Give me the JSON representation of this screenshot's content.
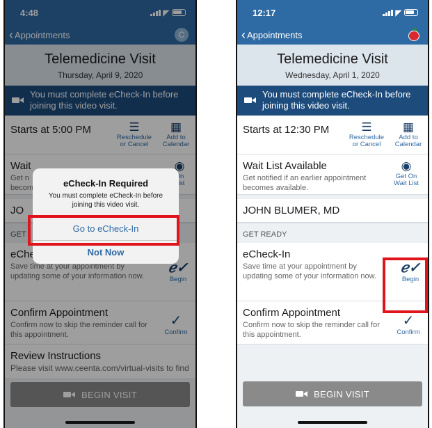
{
  "left": {
    "status": {
      "time": "4:48"
    },
    "nav": {
      "back_label": "Appointments",
      "avatar_initial": "C"
    },
    "header": {
      "title": "Telemedicine Visit",
      "date": "Thursday, April 9, 2020"
    },
    "banner": {
      "text": "You must complete eCheck-In before joining this video visit."
    },
    "starts": {
      "label": "Starts at 5:00 PM",
      "reschedule_label": "Reschedule or Cancel",
      "calendar_label": "Add to Calendar"
    },
    "waitlist": {
      "title": "Wait",
      "desc_line1": "Get n",
      "desc_line2": "becom",
      "action_label_1": "On",
      "action_label_2": "List"
    },
    "provider": {
      "name": "JO"
    },
    "section": {
      "label": "GET"
    },
    "echeckin": {
      "title": "eCheck-In",
      "desc": "Save time at your appointment by updating some of your information now.",
      "action_label": "Begin"
    },
    "confirm": {
      "title": "Confirm Appointment",
      "desc": "Confirm now to skip the reminder call for this appointment.",
      "action_label": "Confirm"
    },
    "review": {
      "title": "Review Instructions",
      "desc": "Please visit www.ceenta.com/virtual-visits to find"
    },
    "begin_visit": {
      "label": "BEGIN VISIT"
    },
    "alert": {
      "title": "eCheck-In Required",
      "message": "You must complete eCheck-In before joining this video visit.",
      "primary_label": "Go to eCheck-In",
      "secondary_label": "Not Now"
    }
  },
  "right": {
    "status": {
      "time": "12:17"
    },
    "nav": {
      "back_label": "Appointments"
    },
    "header": {
      "title": "Telemedicine Visit",
      "date": "Wednesday, April 1, 2020"
    },
    "banner": {
      "text": "You must complete eCheck-In before joining this video visit."
    },
    "starts": {
      "label": "Starts at 12:30 PM",
      "reschedule_label": "Reschedule or Cancel",
      "calendar_label": "Add to Calendar"
    },
    "waitlist": {
      "title": "Wait List Available",
      "desc": "Get notified if an earlier appointment becomes available.",
      "action_label": "Get On Wait List"
    },
    "provider": {
      "name": "JOHN BLUMER, MD"
    },
    "section": {
      "label": "GET READY"
    },
    "echeckin": {
      "title": "eCheck-In",
      "desc": "Save time at your appointment by updating some of your information now.",
      "action_label": "Begin"
    },
    "confirm": {
      "title": "Confirm Appointment",
      "desc": "Confirm now to skip the reminder call for this appointment.",
      "action_label": "Confirm"
    },
    "begin_visit": {
      "label": "BEGIN VISIT"
    }
  },
  "colors": {
    "nav_blue": "#2e6aa3",
    "banner_navy": "#1c4b7c",
    "highlight_red": "#e0151c",
    "disabled_gray": "#8a8a8a"
  },
  "icons": [
    "signal-icon",
    "wifi-icon",
    "battery-icon",
    "back-chevron-icon",
    "camera-icon",
    "calendar-icon",
    "reschedule-icon",
    "waitlist-icon",
    "signature-icon",
    "checkmark-icon",
    "apple-icon"
  ]
}
